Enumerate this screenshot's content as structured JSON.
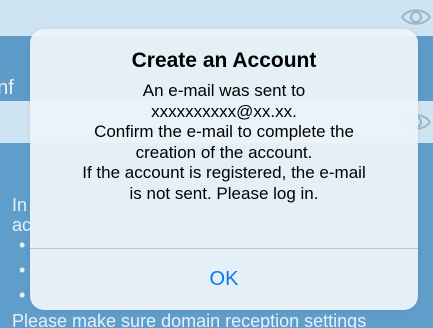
{
  "background": {
    "band_text": "onf",
    "body_line_1": "In",
    "body_line_2": "ac",
    "bullet": "•",
    "bottom_text": "Please make sure domain reception settings"
  },
  "dialog": {
    "title": "Create an Account",
    "lines": [
      "An e-mail was sent to",
      "xxxxxxxxxx@xx.xx.",
      "Confirm the e-mail to complete the",
      "creation of the account.",
      "If the account is registered, the e-mail",
      "is not sent. Please log in."
    ],
    "ok_label": "OK"
  },
  "colors": {
    "accent": "#0A7CF2",
    "overlay_blue": "#5F9DCA"
  },
  "icons": {
    "password_visibility": "eye-icon"
  }
}
